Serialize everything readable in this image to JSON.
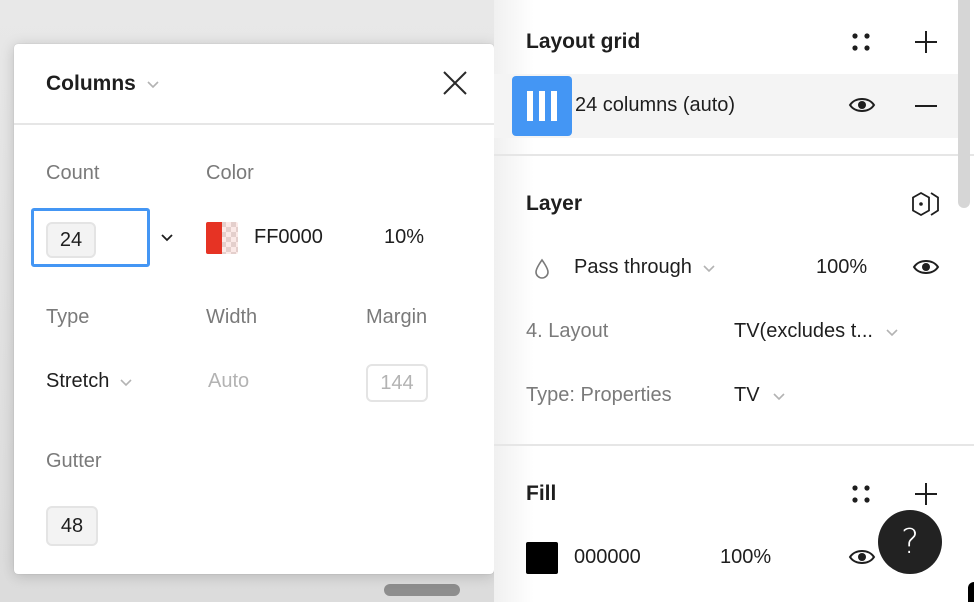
{
  "popover": {
    "title": "Columns",
    "count_label": "Count",
    "count_value": "24",
    "color_label": "Color",
    "color_hex": "FF0000",
    "color_opacity": "10%",
    "type_label": "Type",
    "type_value": "Stretch",
    "width_label": "Width",
    "width_value": "Auto",
    "margin_label": "Margin",
    "margin_value": "144",
    "gutter_label": "Gutter",
    "gutter_value": "48"
  },
  "panel": {
    "layout_grid": {
      "title": "Layout grid",
      "item_label": "24 columns (auto)"
    },
    "layer": {
      "title": "Layer",
      "blend_mode": "Pass through",
      "opacity": "100%",
      "prop1_label": "4. Layout",
      "prop1_value": "TV(excludes t...",
      "prop2_label": "Type: Properties",
      "prop2_value": "TV"
    },
    "fill": {
      "title": "Fill",
      "hex": "000000",
      "opacity": "100%"
    }
  },
  "help": {
    "label": "?"
  },
  "colors": {
    "accent": "#4496f4",
    "grid_color": "#FF0000",
    "fill_color": "#000000"
  }
}
